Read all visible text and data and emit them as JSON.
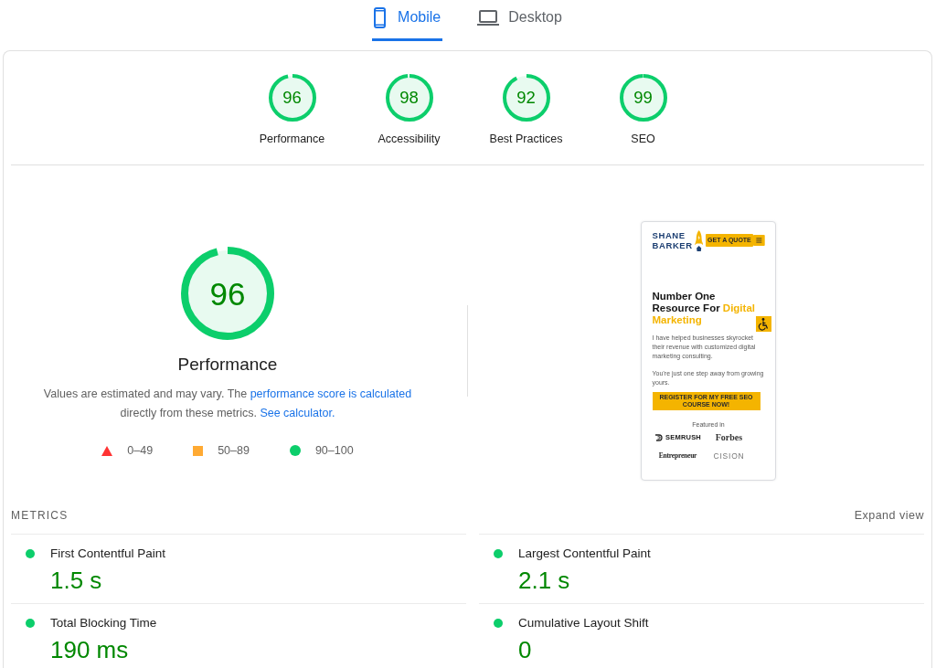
{
  "tabs": [
    {
      "kind": "mobile",
      "label": "Mobile",
      "selected": true
    },
    {
      "kind": "desktop",
      "label": "Desktop",
      "selected": false
    }
  ],
  "categories": [
    {
      "score": "96",
      "label": "Performance"
    },
    {
      "score": "98",
      "label": "Accessibility"
    },
    {
      "score": "92",
      "label": "Best Practices"
    },
    {
      "score": "99",
      "label": "SEO"
    }
  ],
  "performance": {
    "score": "96",
    "title": "Performance",
    "description": [
      {
        "text": "Values are estimated and may vary. The ",
        "link": false
      },
      {
        "text": "performance score is calculated",
        "link": true
      },
      {
        "text": " directly from these metrics. ",
        "link": false
      },
      {
        "text": "See calculator.",
        "link": true
      }
    ],
    "legend": [
      {
        "kind": "triangle",
        "color": "#ff3333",
        "range": "0–49"
      },
      {
        "kind": "square",
        "color": "#ffaa33",
        "range": "50–89"
      },
      {
        "kind": "circle",
        "color": "#0cce6b",
        "range": "90–100"
      }
    ]
  },
  "screenshot": {
    "logo": [
      "SHANE",
      "BARKER"
    ],
    "quote_button": "GET A QUOTE",
    "heading": [
      {
        "text": "Number One Resource For ",
        "highlight": false
      },
      {
        "text": "Digital Marketing",
        "highlight": true
      }
    ],
    "paragraphs": [
      "I have helped businesses skyrocket their revenue with customized digital marketing consulting.",
      "You’re just one step away from growing yours."
    ],
    "cta_button": "REGISTER FOR MY FREE SEO COURSE NOW!",
    "featured_label": "Featured in",
    "logos": [
      {
        "kind": "mark",
        "text": "SEMRUSH"
      },
      {
        "kind": "serif",
        "text": "Forbes"
      },
      {
        "kind": "condensed",
        "text": "Entrepreneur"
      },
      {
        "kind": "spaced",
        "text": "CISION"
      }
    ]
  },
  "metrics": {
    "title": "METRICS",
    "toggle": "Expand view",
    "items": [
      {
        "label": "First Contentful Paint",
        "value": "1.5 s",
        "passed": true
      },
      {
        "label": "Largest Contentful Paint",
        "value": "2.1 s",
        "passed": true
      },
      {
        "label": "Total Blocking Time",
        "value": "190 ms",
        "passed": true
      },
      {
        "label": "Cumulative Layout Shift",
        "value": "0",
        "passed": true
      }
    ]
  }
}
